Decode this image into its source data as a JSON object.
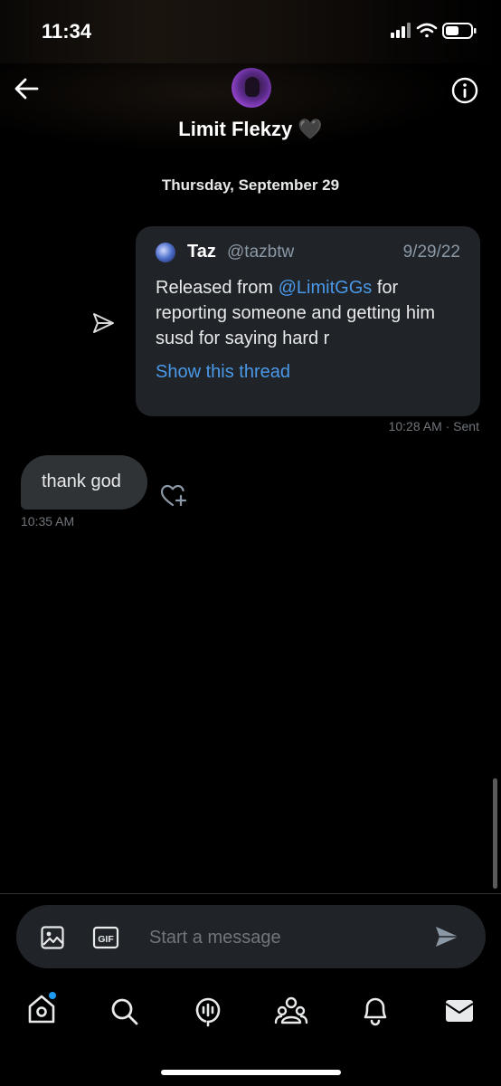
{
  "status_bar": {
    "time": "11:34"
  },
  "header": {
    "contact_name": "Limit Flekzy 🖤",
    "back_icon": "arrow-left-icon",
    "info_icon": "info-circle-icon"
  },
  "conversation": {
    "date_divider": "Thursday, September 29",
    "shared_tweet": {
      "author": "Taz",
      "handle": "@tazbtw",
      "date": "9/29/22",
      "text_before_mention": "Released from ",
      "mention": "@LimitGGs",
      "text_after_mention": " for reporting someone and getting him susd for saying hard r",
      "thread_link": "Show this thread"
    },
    "sent_meta": "10:28 AM · Sent",
    "received_message": {
      "text": "thank god",
      "time": "10:35 AM"
    }
  },
  "composer": {
    "placeholder": "Start a message",
    "gif_label": "GIF",
    "image_icon": "image-icon",
    "send_icon": "send-icon"
  },
  "nav": {
    "items": [
      "home-icon",
      "search-icon",
      "spaces-icon",
      "communities-icon",
      "notifications-icon",
      "messages-icon"
    ]
  },
  "colors": {
    "background": "#000000",
    "accent": "#1d9bf0",
    "link": "#4a99e9",
    "card": "#202327",
    "bubble": "#2f3336",
    "muted": "#71767b"
  }
}
